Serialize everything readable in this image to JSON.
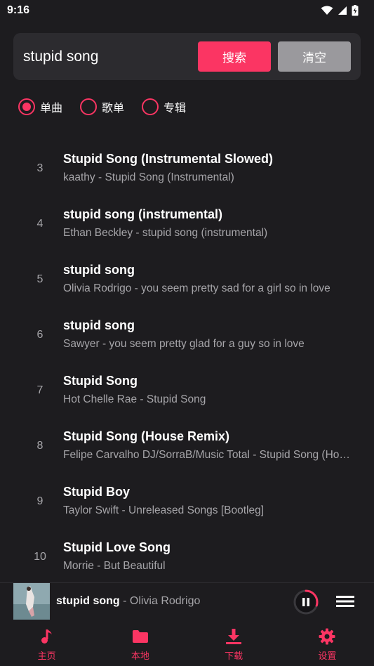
{
  "status_bar": {
    "time": "9:16"
  },
  "search": {
    "query": "stupid song",
    "search_label": "搜索",
    "clear_label": "清空"
  },
  "filter": {
    "options": [
      {
        "label": "单曲",
        "checked": true
      },
      {
        "label": "歌单",
        "checked": false
      },
      {
        "label": "专辑",
        "checked": false
      }
    ]
  },
  "songs": [
    {
      "index": "3",
      "title": "Stupid Song (Instrumental Slowed)",
      "subtitle": "kaathy - Stupid Song (Instrumental)"
    },
    {
      "index": "4",
      "title": "stupid song (instrumental)",
      "subtitle": "Ethan Beckley - stupid song (instrumental)"
    },
    {
      "index": "5",
      "title": "stupid song",
      "subtitle": "Olivia Rodrigo - you seem pretty sad for a girl so in love"
    },
    {
      "index": "6",
      "title": "stupid song",
      "subtitle": "Sawyer - you seem pretty glad for a guy so in love"
    },
    {
      "index": "7",
      "title": "Stupid Song",
      "subtitle": "Hot Chelle Rae - Stupid Song"
    },
    {
      "index": "8",
      "title": "Stupid Song (House Remix)",
      "subtitle": "Felipe Carvalho DJ/SorraB/Music Total - Stupid Song (House Remix)"
    },
    {
      "index": "9",
      "title": "Stupid Boy",
      "subtitle": "Taylor Swift - Unreleased Songs [Bootleg]"
    },
    {
      "index": "10",
      "title": "Stupid Love Song",
      "subtitle": "Morrie - But Beautiful"
    }
  ],
  "player": {
    "title": "stupid song",
    "artist_separator": " - ",
    "artist": "Olivia Rodrigo",
    "state_icon": "pause-icon",
    "progress": 0.3
  },
  "tabs": [
    {
      "label": "主页",
      "icon": "music-note-icon"
    },
    {
      "label": "本地",
      "icon": "folder-icon"
    },
    {
      "label": "下载",
      "icon": "download-icon"
    },
    {
      "label": "设置",
      "icon": "gear-icon"
    }
  ],
  "colors": {
    "accent": "#fb3563",
    "background": "#1d1c1f",
    "card": "#2c2b2f",
    "secondary_text": "#a6a5a9",
    "clear_button": "#9a999d"
  }
}
